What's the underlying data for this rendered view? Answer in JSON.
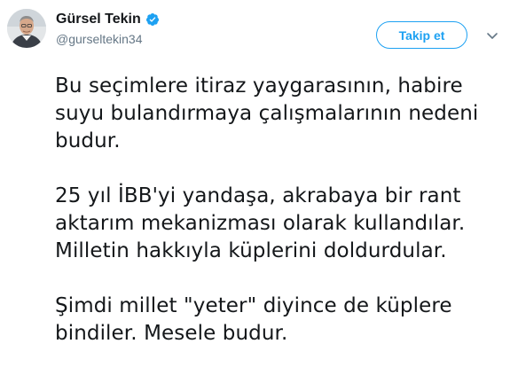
{
  "author": {
    "display_name": "Gürsel Tekin",
    "handle": "@gurseltekin34",
    "verified": true,
    "avatar_icon": "profile-photo"
  },
  "actions": {
    "follow_label": "Takip et",
    "menu_icon": "chevron-down-icon"
  },
  "tweet": {
    "paragraphs": [
      "Bu seçimlere itiraz yaygarasının, habire\nsuyu bulandırmaya çalışmalarının nedeni\nbudur.",
      "25 yıl İBB'yi yandaşa, akrabaya bir rant\naktarım mekanizması olarak kullandılar.\nMilletin hakkıyla küplerini doldurdular.",
      "Şimdi millet \"yeter\" diyince de küplere\nbindiler. Mesele budur."
    ]
  },
  "colors": {
    "accent": "#1da1f2",
    "text": "#14171a",
    "secondary_text": "#657786"
  }
}
